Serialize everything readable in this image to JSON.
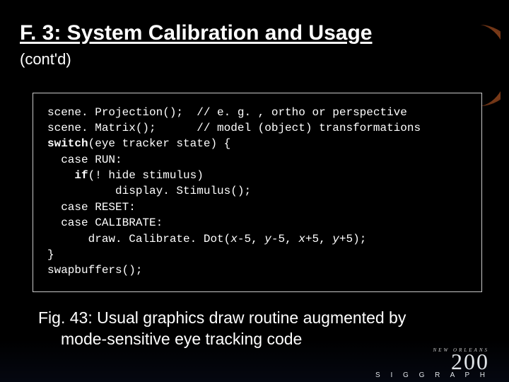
{
  "title": "F. 3: System Calibration and Usage",
  "subtitle": "(cont'd)",
  "code": {
    "l1a": "scene. Projection();  ",
    "l1b": "// e. g. , ortho or perspective",
    "l2a": "scene. Matrix();      ",
    "l2b": "// model (object) transformations",
    "l3a": "switch",
    "l3b": "(eye tracker state) {",
    "l4a": "  case ",
    "l4b": "RUN:",
    "l5a": "    if",
    "l5b": "(! hide stimulus)",
    "l6": "          display. Stimulus();",
    "l7a": "  case ",
    "l7b": "RESET:",
    "l8a": "  case ",
    "l8b": "CALIBRATE:",
    "l9a": "      draw. Calibrate. Dot(",
    "l9b": "x",
    "l9c": "-5, ",
    "l9d": "y",
    "l9e": "-5, ",
    "l9f": "x",
    "l9g": "+5, ",
    "l9h": "y",
    "l9i": "+5);",
    "l10": "}",
    "l11": "swapbuffers();"
  },
  "caption_line1": "Fig. 43: Usual graphics draw routine augmented by",
  "caption_line2": "mode-sensitive eye tracking code",
  "footer": {
    "small": "NEW  ORLEANS",
    "year": "200",
    "sigg": "S I G G R A P H"
  }
}
